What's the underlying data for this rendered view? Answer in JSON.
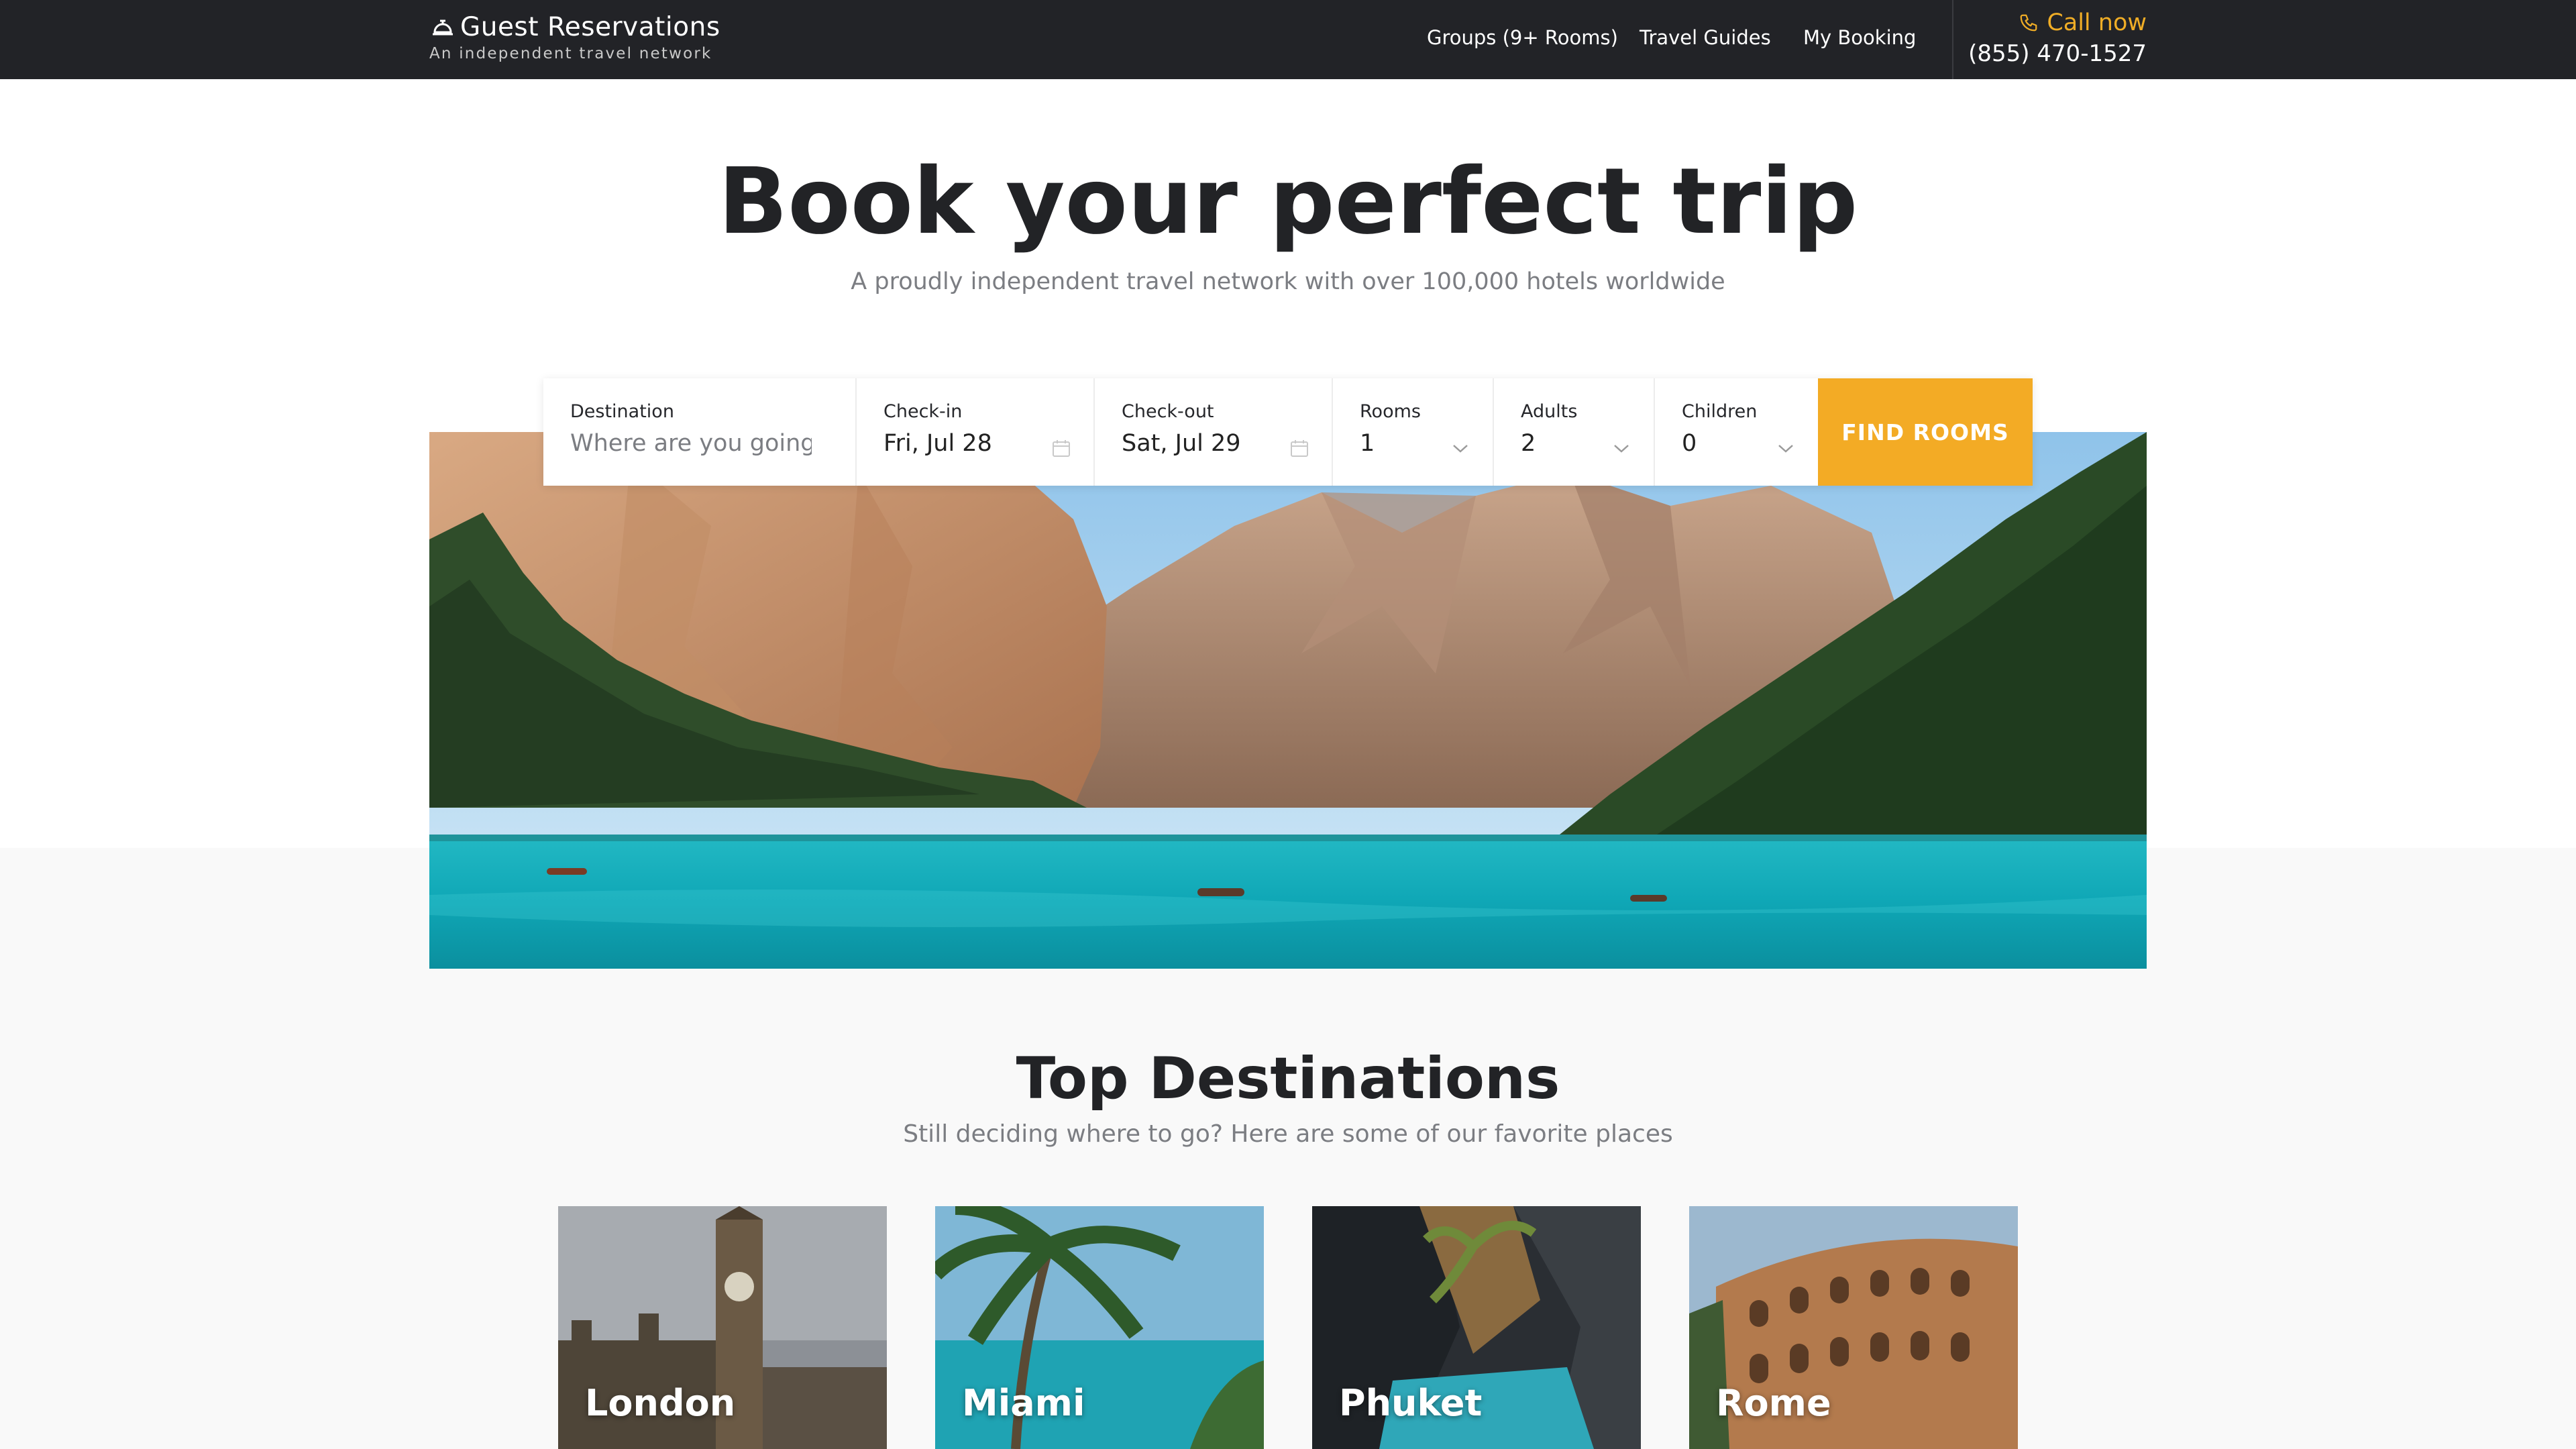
{
  "colors": {
    "navbar": "#222327",
    "accent": "#f3ab25",
    "text_dark": "#222326",
    "text_muted": "#7b7d82"
  },
  "nav": {
    "brand_name": "Guest Reservations",
    "brand_tagline": "An independent travel network",
    "brand_icon": "service-bell-icon",
    "links": [
      "Groups (9+ Rooms)",
      "Travel Guides",
      "My Booking"
    ],
    "call_label": "Call now",
    "call_icon": "phone-icon",
    "phone_number": "(855) 470-1527"
  },
  "hero": {
    "title": "Book your perfect trip",
    "subtitle": "A proudly independent travel network with over 100,000 hotels worldwide"
  },
  "search": {
    "destination": {
      "label": "Destination",
      "placeholder": "Where are you going?"
    },
    "checkin": {
      "label": "Check-in",
      "value": "Fri, Jul 28",
      "icon": "calendar-icon"
    },
    "checkout": {
      "label": "Check-out",
      "value": "Sat, Jul 29",
      "icon": "calendar-icon"
    },
    "rooms": {
      "label": "Rooms",
      "value": "1",
      "icon": "chevron-down-icon"
    },
    "adults": {
      "label": "Adults",
      "value": "2",
      "icon": "chevron-down-icon"
    },
    "children": {
      "label": "Children",
      "value": "0",
      "icon": "chevron-down-icon"
    },
    "button": "FIND ROOMS"
  },
  "destinations": {
    "title": "Top Destinations",
    "subtitle": "Still deciding where to go? Here are some of our favorite places",
    "cards": [
      {
        "name": "London"
      },
      {
        "name": "Miami"
      },
      {
        "name": "Phuket"
      },
      {
        "name": "Rome"
      }
    ]
  }
}
